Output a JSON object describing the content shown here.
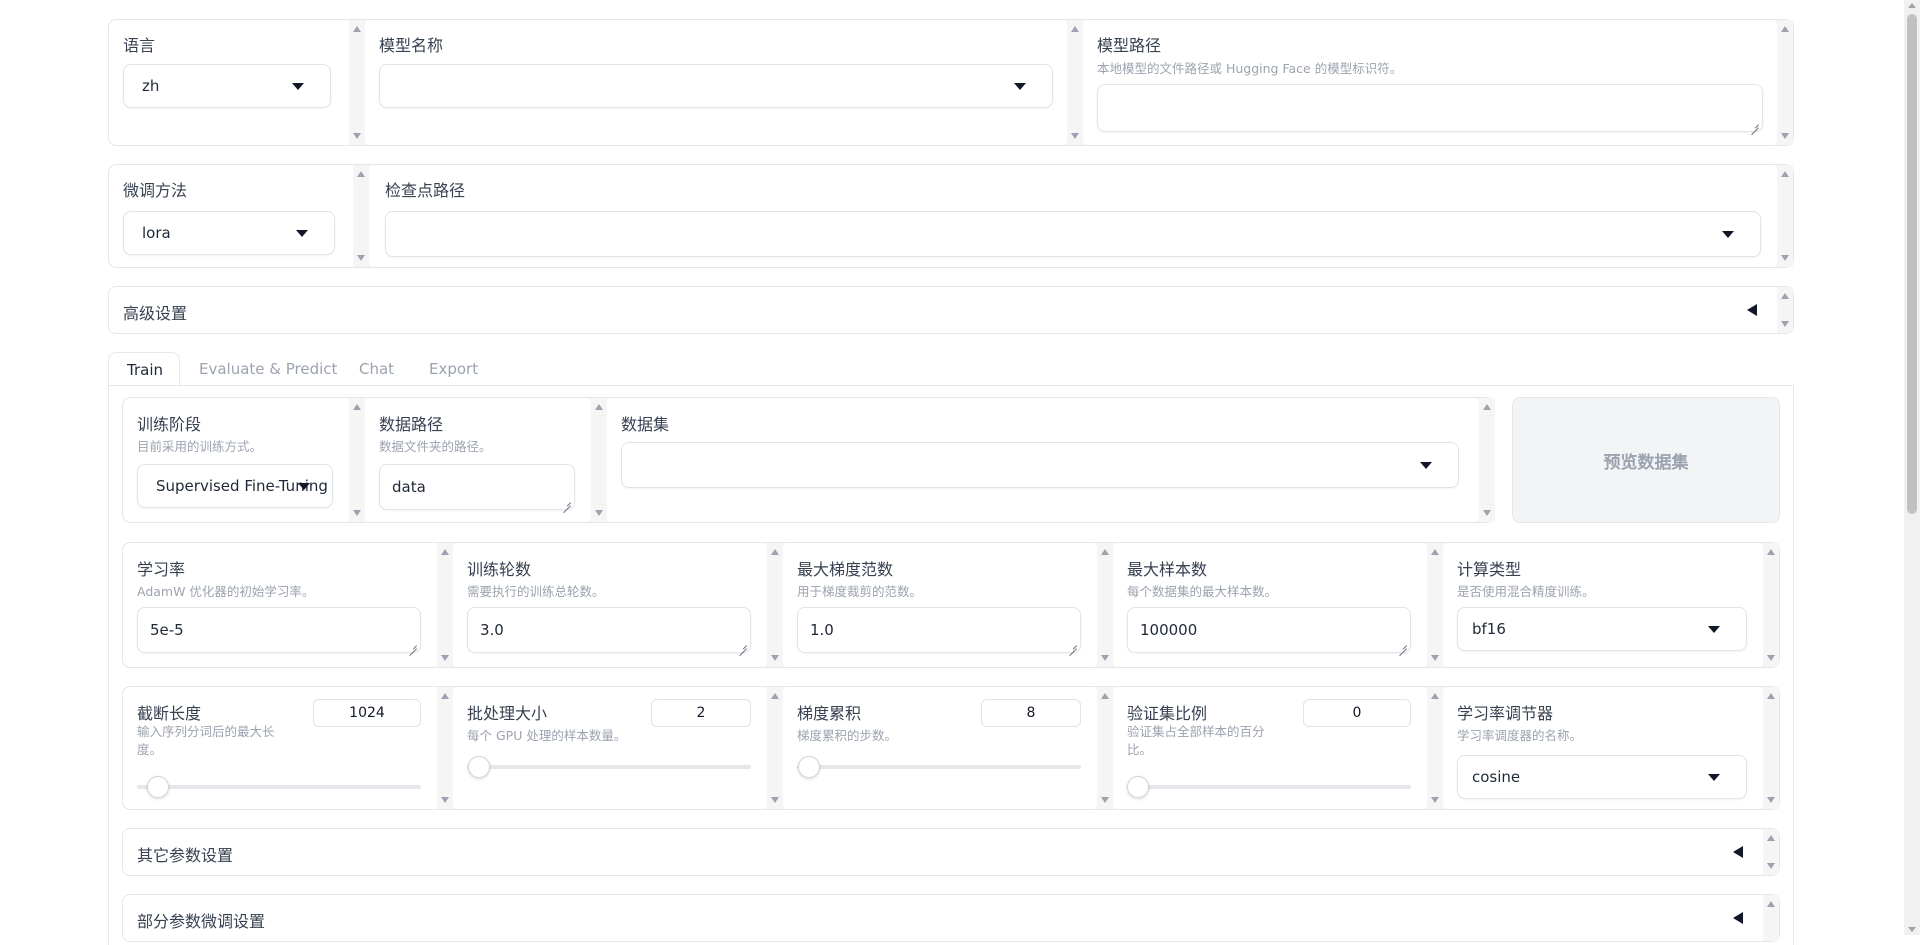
{
  "top": {
    "lang": {
      "label": "语言",
      "value": "zh"
    },
    "model_name": {
      "label": "模型名称",
      "value": ""
    },
    "model_path": {
      "label": "模型路径",
      "info": "本地模型的文件路径或 Hugging Face 的模型标识符。",
      "value": ""
    }
  },
  "finetune": {
    "method": {
      "label": "微调方法",
      "value": "lora"
    },
    "checkpoint": {
      "label": "检查点路径",
      "value": ""
    }
  },
  "advanced": {
    "label": "高级设置"
  },
  "tabs": [
    {
      "label": "Train"
    },
    {
      "label": "Evaluate & Predict"
    },
    {
      "label": "Chat"
    },
    {
      "label": "Export"
    }
  ],
  "train": {
    "stage": {
      "label": "训练阶段",
      "info": "目前采用的训练方式。",
      "value": "Supervised Fine-Tuning"
    },
    "data_dir": {
      "label": "数据路径",
      "info": "数据文件夹的路径。",
      "value": "data"
    },
    "dataset": {
      "label": "数据集",
      "value": ""
    },
    "preview_button": "预览数据集",
    "learning_rate": {
      "label": "学习率",
      "info": "AdamW 优化器的初始学习率。",
      "value": "5e-5"
    },
    "epochs": {
      "label": "训练轮数",
      "info": "需要执行的训练总轮数。",
      "value": "3.0"
    },
    "max_grad_norm": {
      "label": "最大梯度范数",
      "info": "用于梯度裁剪的范数。",
      "value": "1.0"
    },
    "max_samples": {
      "label": "最大样本数",
      "info": "每个数据集的最大样本数。",
      "value": "100000"
    },
    "compute_type": {
      "label": "计算类型",
      "info": "是否使用混合精度训练。",
      "value": "bf16"
    },
    "cutoff_len": {
      "label": "截断长度",
      "info": "输入序列分词后的最大长度。",
      "value": "1024",
      "level": 0.04
    },
    "batch_size": {
      "label": "批处理大小",
      "info": "每个 GPU 处理的样本数量。",
      "value": "2",
      "level": 0.004
    },
    "grad_accum": {
      "label": "梯度累积",
      "info": "梯度累积的步数。",
      "value": "8",
      "level": 0.003
    },
    "val_size": {
      "label": "验证集比例",
      "info": "验证集占全部样本的百分比。",
      "value": "0",
      "level": 0.0
    },
    "lr_scheduler": {
      "label": "学习率调节器",
      "info": "学习率调度器的名称。",
      "value": "cosine"
    },
    "other_params": {
      "label": "其它参数设置"
    },
    "partial_params": {
      "label": "部分参数微调设置"
    }
  }
}
